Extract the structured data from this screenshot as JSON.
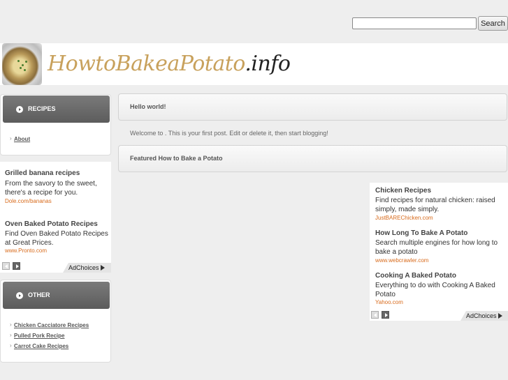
{
  "search": {
    "placeholder": "",
    "value": "",
    "button_label": "Search"
  },
  "site": {
    "logo_main": "HowtoBakeaPotato",
    "logo_tld": ".info"
  },
  "sidebar": {
    "recipes": {
      "title": "RECIPES",
      "links": [
        {
          "label": "About"
        }
      ]
    },
    "other": {
      "title": "OTHER",
      "links": [
        {
          "label": "Chicken Cacciatore Recipes"
        },
        {
          "label": "Pulled Pork Recipe"
        },
        {
          "label": "Carrot Cake Recipes"
        }
      ]
    }
  },
  "left_ads": {
    "items": [
      {
        "title": "Grilled banana recipes",
        "desc": "From the savory to the sweet, there's a recipe for you.",
        "url": "Dole.com/bananas"
      },
      {
        "title": "Oven Baked Potato Recipes",
        "desc": "Find Oven Baked Potato Recipes at Great Prices.",
        "url": "www.Pronto.com"
      }
    ],
    "adchoices_label": "AdChoices"
  },
  "main": {
    "posts": [
      {
        "title": "Hello world!",
        "body": "Welcome to . This is your first post. Edit or delete it, then start blogging!"
      },
      {
        "title": "Featured How to Bake a Potato"
      }
    ]
  },
  "right_ads": {
    "items": [
      {
        "title": "Chicken Recipes",
        "desc": "Find recipes for natural chicken: raised simply, made simply.",
        "url": "JustBAREChicken.com"
      },
      {
        "title": "How Long To Bake A Potato",
        "desc": "Search multiple engines for how long to bake a potato",
        "url": "www.webcrawler.com"
      },
      {
        "title": "Cooking A Baked Potato",
        "desc": "Everything to do with Cooking A Baked Potato",
        "url": "Yahoo.com"
      }
    ],
    "adchoices_label": "AdChoices"
  },
  "colors": {
    "background": "#eeeeee",
    "panel_header": "#666666",
    "ad_url": "#d86b1c",
    "logo_gold": "#c8a15c"
  }
}
